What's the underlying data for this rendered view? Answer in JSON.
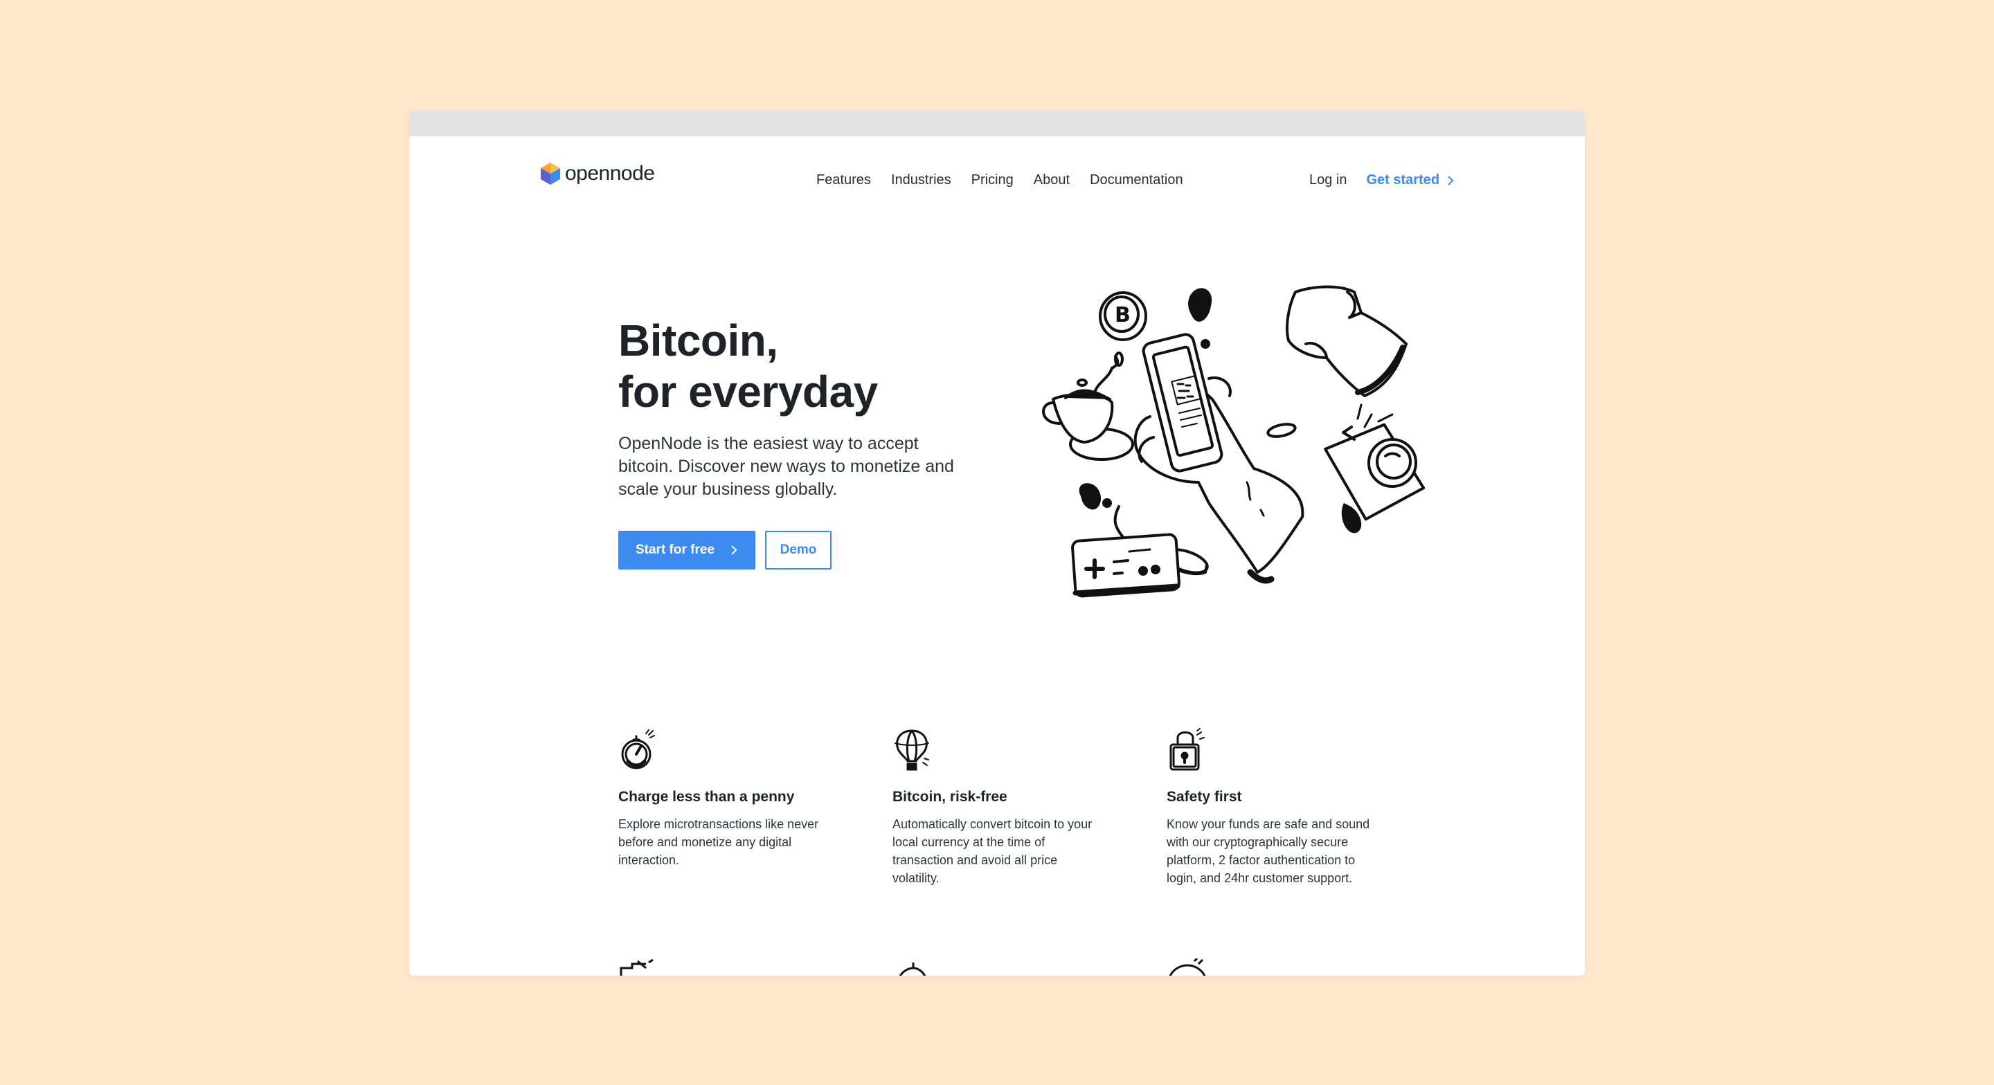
{
  "nav": {
    "logo_text": "opennode",
    "links": [
      "Features",
      "Industries",
      "Pricing",
      "About",
      "Documentation"
    ],
    "login": "Log in",
    "get_started": "Get started"
  },
  "hero": {
    "title_line1": "Bitcoin,",
    "title_line2": "for everyday",
    "description": "OpenNode is the easiest way to accept bitcoin. Discover new ways to monetize and scale your business globally.",
    "primary_button": "Start for free",
    "secondary_button": "Demo"
  },
  "features": [
    {
      "icon": "stopwatch-icon",
      "title": "Charge less than a penny",
      "text": "Explore microtransactions like never before and monetize any digital interaction."
    },
    {
      "icon": "hot-air-balloon-icon",
      "title": "Bitcoin, risk-free",
      "text": "Automatically convert bitcoin to your local currency at the time of transaction and avoid all price volatility."
    },
    {
      "icon": "padlock-icon",
      "title": "Safety first",
      "text": "Know your funds are safe and sound with our cryptographically secure platform, 2 factor authentication to login, and 24hr customer support."
    }
  ],
  "colors": {
    "background": "#ffe8cc",
    "accent": "#3d8bf0",
    "text": "#1f2329"
  }
}
